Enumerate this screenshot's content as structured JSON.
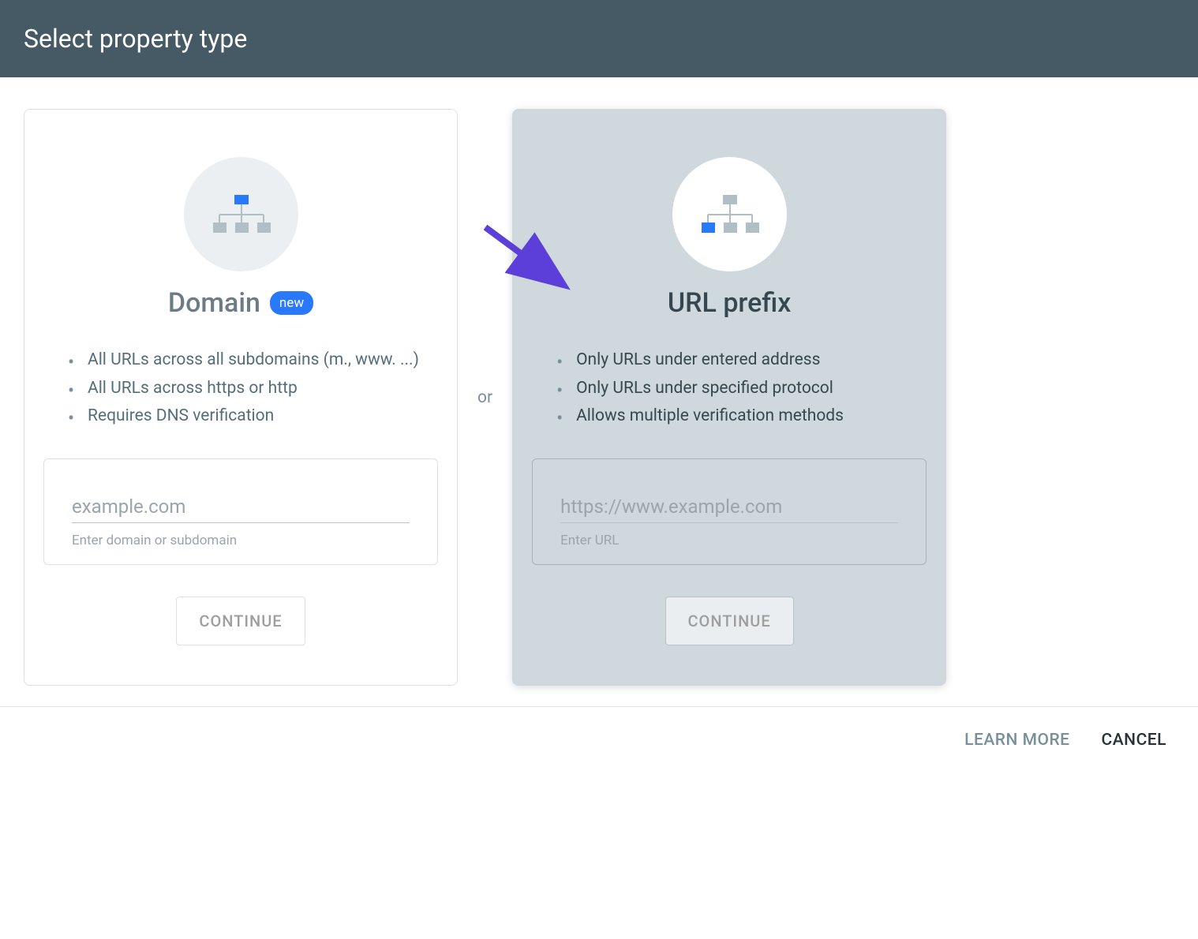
{
  "header": {
    "title": "Select property type"
  },
  "separator": {
    "or": "or"
  },
  "domain_card": {
    "title": "Domain",
    "badge": "new",
    "bullets": [
      "All URLs across all subdomains (m., www. ...)",
      "All URLs across https or http",
      "Requires DNS verification"
    ],
    "input_placeholder": "example.com",
    "input_helper": "Enter domain or subdomain",
    "continue": "CONTINUE"
  },
  "url_prefix_card": {
    "title": "URL prefix",
    "bullets": [
      "Only URLs under entered address",
      "Only URLs under specified protocol",
      "Allows multiple verification methods"
    ],
    "input_placeholder": "https://www.example.com",
    "input_helper": "Enter URL",
    "continue": "CONTINUE"
  },
  "footer": {
    "learn_more": "LEARN MORE",
    "cancel": "CANCEL"
  }
}
